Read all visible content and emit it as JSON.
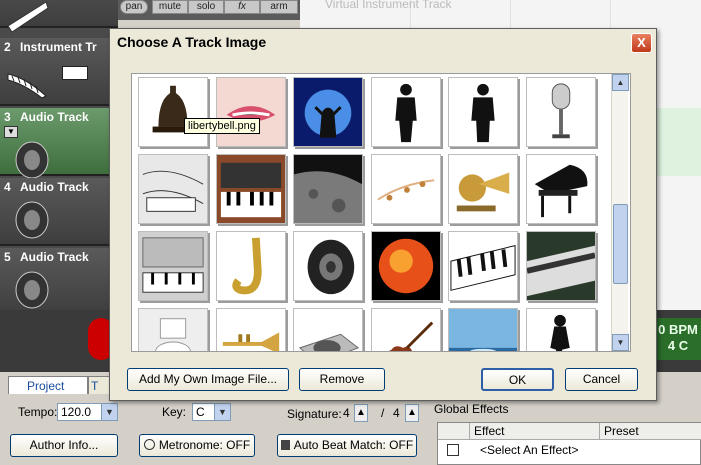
{
  "header_buttons": {
    "pan": "pan",
    "mute": "mute",
    "solo": "solo",
    "fx": "fx",
    "arm": "arm"
  },
  "virtual_track_label": "Virtual Instrument Track",
  "tracks": [
    {
      "num": "",
      "name": ""
    },
    {
      "num": "2",
      "name": "Instrument Tr"
    },
    {
      "num": "3",
      "name": "Audio Track"
    },
    {
      "num": "4",
      "name": "Audio Track"
    },
    {
      "num": "5",
      "name": "Audio Track"
    }
  ],
  "bpm": {
    "value": "0 BPM",
    "key": "4   C"
  },
  "tabs": {
    "project": "Project",
    "second": "T"
  },
  "settings": {
    "tempo_label": "Tempo:",
    "tempo_value": "120.0",
    "key_label": "Key:",
    "key_value": "C",
    "signature_label": "Signature:",
    "sig_top": "4",
    "sig_slash": "/",
    "sig_bottom": "4",
    "global_effects_label": "Global Effects"
  },
  "buttons": {
    "author_info": "Author Info...",
    "metronome": "Metronome: OFF",
    "auto_beat": "Auto Beat Match: OFF"
  },
  "effects_table": {
    "col_effect": "Effect",
    "col_preset": "Preset",
    "row_placeholder": "<Select An Effect>"
  },
  "dialog": {
    "title": "Choose A Track Image",
    "close": "X",
    "tooltip": "libertybell.png",
    "add_image_label": "Add My Own Image File...",
    "remove_label": "Remove",
    "ok_label": "OK",
    "cancel_label": "Cancel",
    "images": [
      "liberty-bell",
      "lips",
      "concert-silhouette",
      "man-silhouette",
      "man-silhouette-2",
      "microphone",
      "circuit-keyboard",
      "synth-keyboard",
      "moon-surface",
      "music-notes",
      "brass-instruments",
      "grand-piano",
      "synth-modules",
      "saxophone",
      "speaker",
      "sun",
      "piano-keys",
      "keyboard-angled",
      "toilet",
      "trumpet",
      "turntable",
      "violin",
      "water-drop",
      "woman-silhouette"
    ]
  }
}
